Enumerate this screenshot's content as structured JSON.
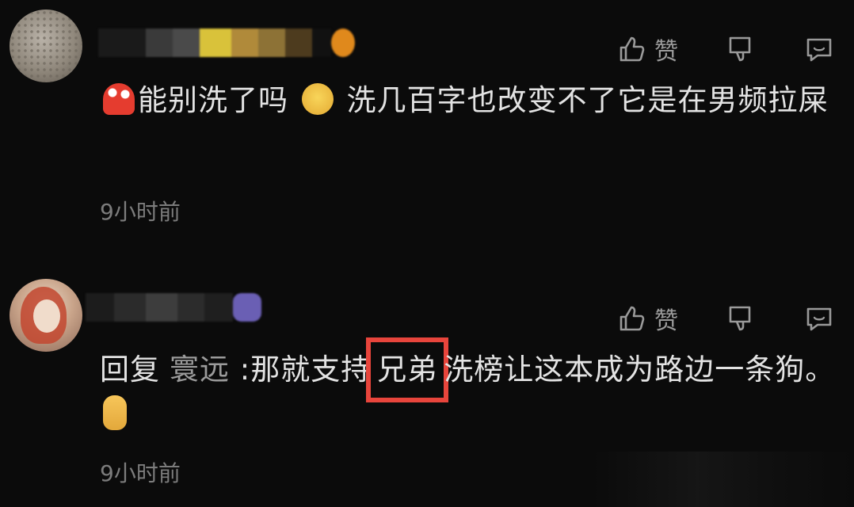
{
  "comments": [
    {
      "avatar": "avatar-image",
      "text_parts": {
        "emoji1": "mushroom-emoji",
        "part1": "能别洗了吗",
        "emoji2": "sick-face-emoji",
        "part2": "洗几百字也改变不了它是在男频拉屎"
      },
      "time": "9小时前",
      "actions": {
        "like_label": "赞",
        "like_icon": "thumbs-up-icon",
        "dislike_icon": "thumbs-down-icon",
        "reply_icon": "comment-icon"
      }
    },
    {
      "avatar": "avatar-image",
      "reply_label": "回复",
      "reply_to": "寰远",
      "text_parts": {
        "part1": ":那就支持",
        "highlight": "兄弟",
        "part2": "洗榜让这本成为路边一条狗。",
        "emoji": "crossed-fingers-emoji"
      },
      "time": "9小时前",
      "actions": {
        "like_label": "赞",
        "like_icon": "thumbs-up-icon",
        "dislike_icon": "thumbs-down-icon",
        "reply_icon": "comment-icon"
      }
    }
  ],
  "colors": {
    "background": "#0b0b0b",
    "text": "#e3e3e3",
    "muted": "#7c7c7c",
    "highlight": "#e8453c"
  }
}
